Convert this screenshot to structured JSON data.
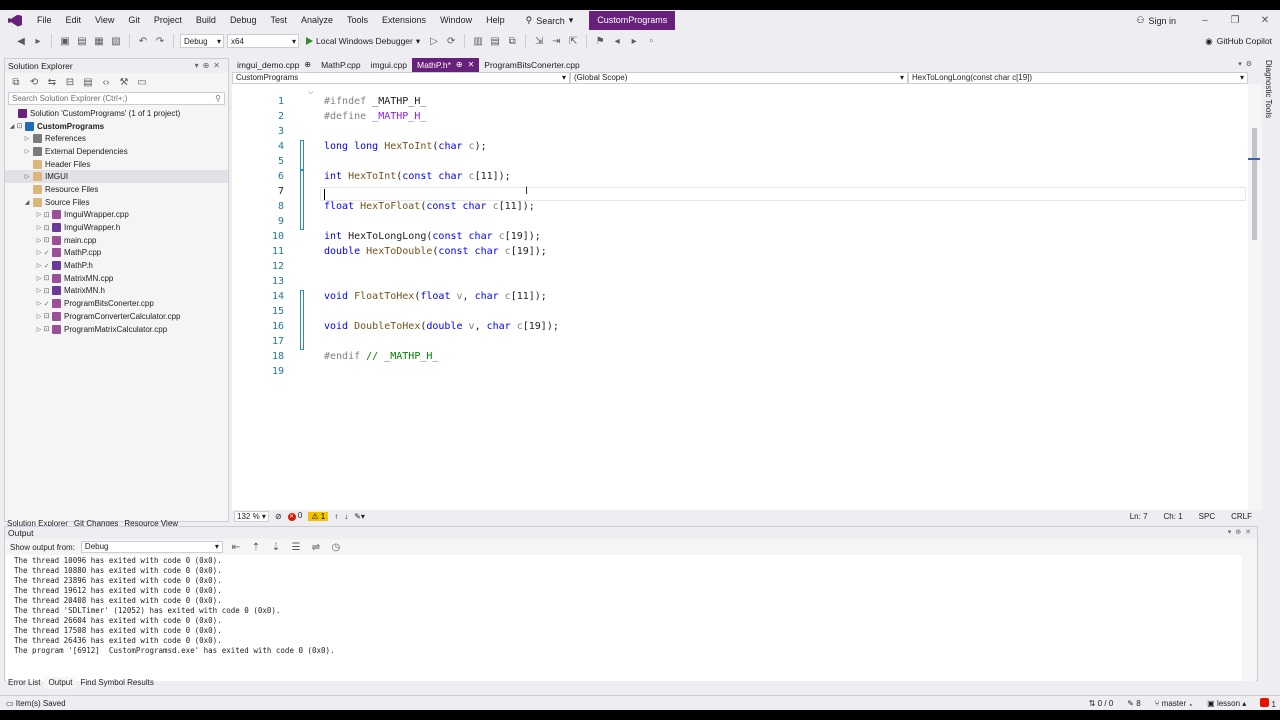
{
  "menubar": {
    "items": [
      "File",
      "Edit",
      "View",
      "Git",
      "Project",
      "Build",
      "Debug",
      "Test",
      "Analyze",
      "Tools",
      "Extensions",
      "Window",
      "Help"
    ],
    "search_label": "Search",
    "project_name": "CustomPrograms",
    "sign_in": "Sign in",
    "window_controls": [
      "–",
      "❐",
      "✕"
    ]
  },
  "toolbar": {
    "configuration": "Debug",
    "platform": "x64",
    "run_label": "Local Windows Debugger",
    "copilot_label": "GitHub Copilot"
  },
  "solution_explorer": {
    "title": "Solution Explorer",
    "search_placeholder": "Search Solution Explorer (Ctrl+;)",
    "items": [
      {
        "label": "Solution 'CustomPrograms' (1 of 1 project)"
      },
      {
        "label": "CustomPrograms"
      },
      {
        "label": "References"
      },
      {
        "label": "External Dependencies"
      },
      {
        "label": "Header Files"
      },
      {
        "label": "IMGUI"
      },
      {
        "label": "Resource Files"
      },
      {
        "label": "Source Files"
      },
      {
        "label": "ImguiWrapper.cpp"
      },
      {
        "label": "ImguiWrapper.h"
      },
      {
        "label": "main.cpp"
      },
      {
        "label": "MathP.cpp"
      },
      {
        "label": "MathP.h"
      },
      {
        "label": "MatrixMN.cpp"
      },
      {
        "label": "MatrixMN.h"
      },
      {
        "label": "ProgramBitsConerter.cpp"
      },
      {
        "label": "ProgramConverterCalculator.cpp"
      },
      {
        "label": "ProgramMatrixCalculator.cpp"
      }
    ],
    "tabs": [
      "Solution Explorer",
      "Git Changes",
      "Resource View"
    ]
  },
  "editor": {
    "tabs": [
      {
        "label": "imgui_demo.cpp",
        "marker": "⊕"
      },
      {
        "label": "MathP.cpp",
        "marker": ""
      },
      {
        "label": "imgui.cpp",
        "marker": ""
      },
      {
        "label": "MathP.h*",
        "marker": "⊕"
      },
      {
        "label": "ProgramBitsConerter.cpp",
        "marker": ""
      }
    ],
    "close_glyph": "✕",
    "nav_project": "CustomPrograms",
    "nav_scope": "(Global Scope)",
    "nav_member": "HexToLongLong(const char c[19])",
    "line_numbers": [
      "1",
      "2",
      "3",
      "4",
      "5",
      "6",
      "7",
      "8",
      "9",
      "10",
      "11",
      "12",
      "13",
      "14",
      "15",
      "16",
      "17",
      "18",
      "19"
    ],
    "code_lines": [
      [
        {
          "t": "#ifndef ",
          "c": "#808080"
        },
        {
          "t": "_MATHP_H_",
          "c": "#1e1e1e"
        }
      ],
      [
        {
          "t": "#define ",
          "c": "#808080"
        },
        {
          "t": "_MATHP_H_",
          "c": "#8a1bff"
        }
      ],
      [],
      [
        {
          "t": "long long ",
          "c": "#0000ff"
        },
        {
          "t": "HexToInt",
          "c": "#74531f"
        },
        {
          "t": "(",
          "c": "#1e1e1e"
        },
        {
          "t": "char ",
          "c": "#0000ff"
        },
        {
          "t": "c",
          "c": "#808080"
        },
        {
          "t": ");",
          "c": "#1e1e1e"
        }
      ],
      [],
      [
        {
          "t": "int ",
          "c": "#0000ff"
        },
        {
          "t": "HexToInt",
          "c": "#74531f"
        },
        {
          "t": "(",
          "c": "#1e1e1e"
        },
        {
          "t": "const char ",
          "c": "#0000ff"
        },
        {
          "t": "c",
          "c": "#808080"
        },
        {
          "t": "[11]);",
          "c": "#1e1e1e"
        }
      ],
      [],
      [
        {
          "t": "float ",
          "c": "#0000ff"
        },
        {
          "t": "HexToFloat",
          "c": "#74531f"
        },
        {
          "t": "(",
          "c": "#1e1e1e"
        },
        {
          "t": "const char ",
          "c": "#0000ff"
        },
        {
          "t": "c",
          "c": "#808080"
        },
        {
          "t": "[11]);",
          "c": "#1e1e1e"
        }
      ],
      [],
      [
        {
          "t": "int ",
          "c": "#0000ff"
        },
        {
          "t": "HexToLongLong",
          "c": "#1e1e1e"
        },
        {
          "t": "(",
          "c": "#1e1e1e"
        },
        {
          "t": "const char ",
          "c": "#0000ff"
        },
        {
          "t": "c",
          "c": "#808080"
        },
        {
          "t": "[19]);",
          "c": "#1e1e1e"
        }
      ],
      [
        {
          "t": "double ",
          "c": "#0000ff"
        },
        {
          "t": "HexToDouble",
          "c": "#74531f"
        },
        {
          "t": "(",
          "c": "#1e1e1e"
        },
        {
          "t": "const char ",
          "c": "#0000ff"
        },
        {
          "t": "c",
          "c": "#808080"
        },
        {
          "t": "[19]);",
          "c": "#1e1e1e"
        }
      ],
      [],
      [],
      [
        {
          "t": "void ",
          "c": "#0000ff"
        },
        {
          "t": "FloatToHex",
          "c": "#74531f"
        },
        {
          "t": "(",
          "c": "#1e1e1e"
        },
        {
          "t": "float ",
          "c": "#0000ff"
        },
        {
          "t": "v",
          "c": "#808080"
        },
        {
          "t": ", ",
          "c": "#1e1e1e"
        },
        {
          "t": "char ",
          "c": "#0000ff"
        },
        {
          "t": "c",
          "c": "#808080"
        },
        {
          "t": "[11]);",
          "c": "#1e1e1e"
        }
      ],
      [],
      [
        {
          "t": "void ",
          "c": "#0000ff"
        },
        {
          "t": "DoubleToHex",
          "c": "#74531f"
        },
        {
          "t": "(",
          "c": "#1e1e1e"
        },
        {
          "t": "double ",
          "c": "#0000ff"
        },
        {
          "t": "v",
          "c": "#808080"
        },
        {
          "t": ", ",
          "c": "#1e1e1e"
        },
        {
          "t": "char ",
          "c": "#0000ff"
        },
        {
          "t": "c",
          "c": "#808080"
        },
        {
          "t": "[19]);",
          "c": "#1e1e1e"
        }
      ],
      [],
      [
        {
          "t": "#endif ",
          "c": "#808080"
        },
        {
          "t": "// _MATHP_H_",
          "c": "#008000"
        }
      ],
      []
    ],
    "current_line": "7",
    "zoom": "132 %",
    "errors": "0",
    "warnings": "1",
    "position": "Ln: 7",
    "column": "Ch: 1",
    "whitespace": "SPC",
    "line_endings": "CRLF"
  },
  "diagnostic_tools_label": "Diagnostic Tools",
  "output": {
    "title": "Output",
    "show_from_label": "Show output from:",
    "source": "Debug",
    "lines": [
      "The thread 10096 has exited with code 0 (0x0).",
      "The thread 10880 has exited with code 0 (0x0).",
      "The thread 23896 has exited with code 0 (0x0).",
      "The thread 19612 has exited with code 0 (0x0).",
      "The thread 20408 has exited with code 0 (0x0).",
      "The thread 'SDLTimer' (12052) has exited with code 0 (0x0).",
      "The thread 26604 has exited with code 0 (0x0).",
      "The thread 17508 has exited with code 0 (0x0).",
      "The thread 26436 has exited with code 0 (0x0).",
      "The program '[6912]  CustomProgramsd.exe' has exited with code 0 (0x0)."
    ]
  },
  "bottom_tabs": [
    "Error List",
    "Output",
    "Find Symbol Results"
  ],
  "statusbar": {
    "message": "Item(s) Saved",
    "sync": "0 / 0",
    "edits": "8",
    "branch": "master",
    "repo": "lesson",
    "notifications": "1"
  },
  "colors": {
    "accent": "#68217a",
    "keyword": "#0000ff",
    "function": "#74531f",
    "comment": "#008000",
    "preprocessor": "#808080"
  }
}
